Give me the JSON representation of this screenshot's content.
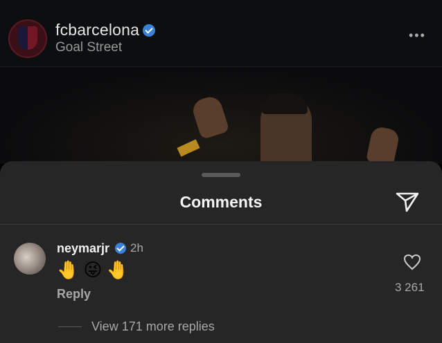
{
  "post": {
    "account": "fcbarcelona",
    "location": "Goal Street",
    "more_icon": "more-horizontal-icon"
  },
  "comments_sheet": {
    "title": "Comments",
    "share_icon": "send-icon"
  },
  "comment": {
    "username": "neymarjr",
    "time": "2h",
    "text": "🤚😜🤚",
    "reply_label": "Reply",
    "like_count": "3 261",
    "like_icon": "heart-icon",
    "view_replies": "View 171 more replies"
  },
  "colors": {
    "verified": "#3b82d6",
    "sheet_bg": "#262626"
  }
}
